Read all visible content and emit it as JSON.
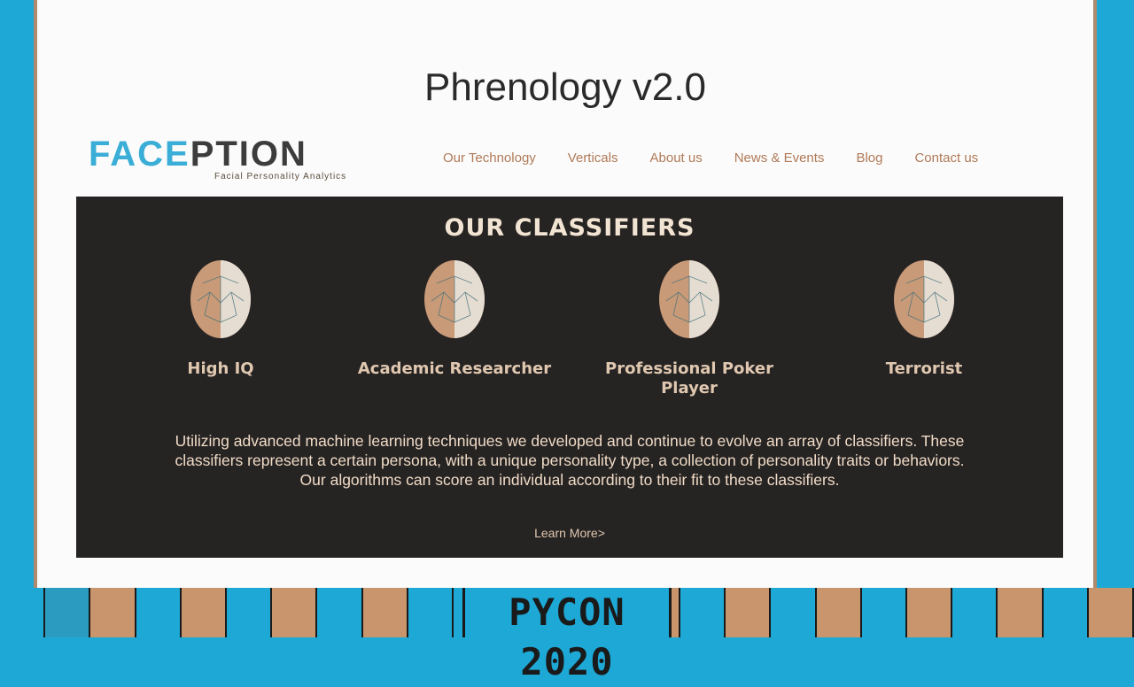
{
  "slide": {
    "title": "Phrenology v2.0"
  },
  "site": {
    "logo_part1": "FACE",
    "logo_part2": "PTION",
    "tagline": "Facial Personality Analytics",
    "nav": [
      "Our Technology",
      "Verticals",
      "About us",
      "News & Events",
      "Blog",
      "Contact us"
    ]
  },
  "panel": {
    "heading": "OUR CLASSIFIERS",
    "classifiers": [
      {
        "label": "High IQ"
      },
      {
        "label": "Academic Researcher"
      },
      {
        "label": "Professional Poker Player"
      },
      {
        "label": "Terrorist"
      }
    ],
    "description": "Utilizing advanced machine learning techniques we developed and continue to evolve an array of classifiers. These classifiers represent a certain persona, with a unique personality type, a collection of personality traits or behaviors. Our algorithms can score an individual according to their fit to these classifiers.",
    "learn_more": "Learn More>"
  },
  "banner": {
    "event": "PYCON 2020"
  },
  "colors": {
    "accent_blue": "#1da8d6",
    "panel_bg": "#262323",
    "nav_text": "#b07a58",
    "face_tone": "#c89a78"
  }
}
